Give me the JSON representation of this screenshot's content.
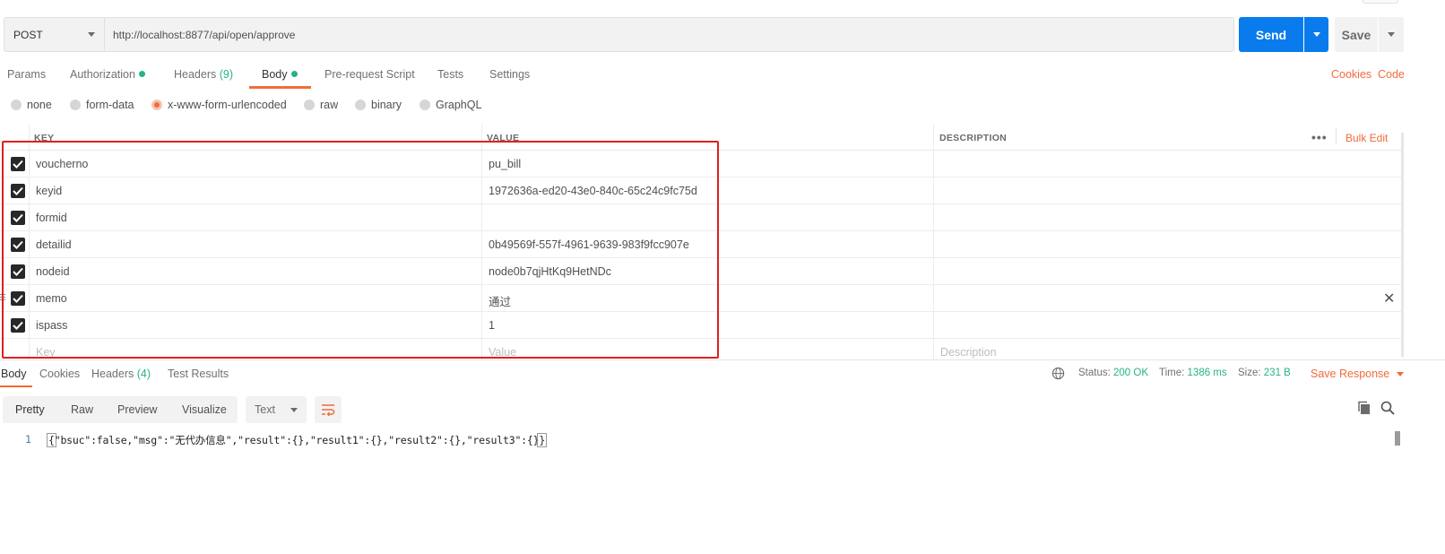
{
  "request": {
    "method": "POST",
    "url": "http://localhost:8877/api/open/approve",
    "send_label": "Send",
    "save_label": "Save"
  },
  "tabs": [
    {
      "label": "Params"
    },
    {
      "label": "Authorization"
    },
    {
      "label": "Headers",
      "count": "(9)"
    },
    {
      "label": "Body"
    },
    {
      "label": "Pre-request Script"
    },
    {
      "label": "Tests"
    },
    {
      "label": "Settings"
    }
  ],
  "links": {
    "cookies": "Cookies",
    "code": "Code"
  },
  "body_types": [
    {
      "label": "none"
    },
    {
      "label": "form-data"
    },
    {
      "label": "x-www-form-urlencoded",
      "selected": true
    },
    {
      "label": "raw"
    },
    {
      "label": "binary"
    },
    {
      "label": "GraphQL"
    }
  ],
  "params_table": {
    "headers": {
      "key": "KEY",
      "value": "VALUE",
      "description": "DESCRIPTION"
    },
    "bulk_edit": "Bulk Edit",
    "more": "•••",
    "rows": [
      {
        "key": "voucherno",
        "value": "pu_bill",
        "checked": true
      },
      {
        "key": "keyid",
        "value": "1972636a-ed20-43e0-840c-65c24c9fc75d",
        "checked": true
      },
      {
        "key": "formid",
        "value": "",
        "checked": true
      },
      {
        "key": "detailid",
        "value": "0b49569f-557f-4961-9639-983f9fcc907e",
        "checked": true
      },
      {
        "key": "nodeid",
        "value": "node0b7qjHtKq9HetNDc",
        "checked": true
      },
      {
        "key": "memo",
        "value": "通过",
        "checked": true
      },
      {
        "key": "ispass",
        "value": "1",
        "checked": true
      }
    ],
    "placeholder_row": {
      "key": "Key",
      "value": "Value",
      "description": "Description"
    },
    "delete_glyph": "✕"
  },
  "response": {
    "tabs": [
      {
        "label": "Body"
      },
      {
        "label": "Cookies"
      },
      {
        "label": "Headers",
        "count": "(4)"
      },
      {
        "label": "Test Results"
      }
    ],
    "status_label": "Status:",
    "status_value": "200 OK",
    "time_label": "Time:",
    "time_value": "1386 ms",
    "size_label": "Size:",
    "size_value": "231 B",
    "save_response": "Save Response",
    "views": [
      "Pretty",
      "Raw",
      "Preview",
      "Visualize"
    ],
    "format": "Text",
    "line_number": "1",
    "code_open": "{",
    "code_body": "\"bsuc\":false,\"msg\":\"无代办信息\",\"result\":{},\"result1\":{},\"result2\":{},\"result3\":{}",
    "code_close": "}"
  },
  "colors": {
    "accent": "#f26b3a",
    "primary": "#097bed",
    "success": "#26b47f",
    "highlight_box": "#e02020"
  }
}
